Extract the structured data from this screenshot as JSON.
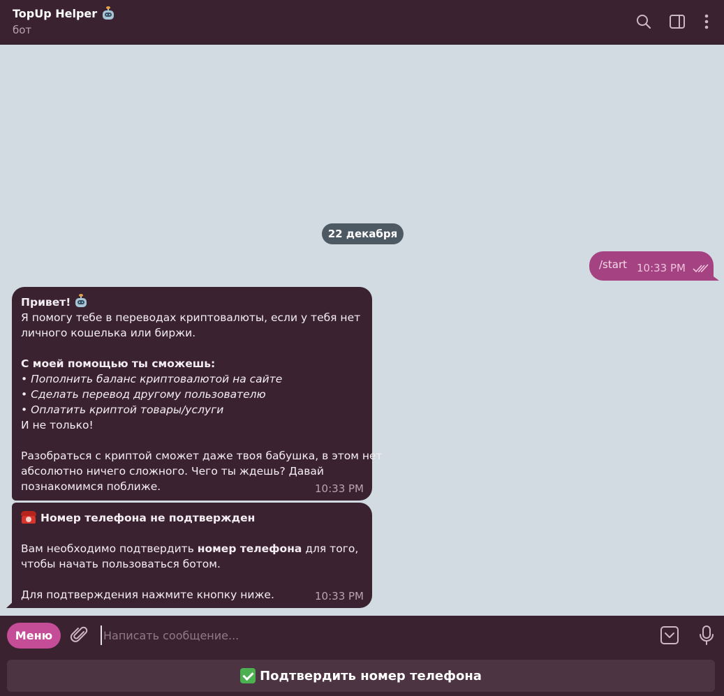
{
  "header": {
    "title": "TopUp Helper",
    "title_emoji": "robot",
    "subtitle": "бот",
    "icons": [
      "search-icon",
      "sidebar-toggle-icon",
      "more-vertical-icon"
    ]
  },
  "chat": {
    "date_separator": "22 декабря",
    "outgoing": {
      "text": "/start",
      "time": "10:33 PM",
      "status": "read"
    },
    "welcome": {
      "greeting": "Привет!",
      "line1": "Я помогу тебе в переводах криптовалюты, если у тебя нет",
      "line2": "личного кошелька или биржи.",
      "features_title": "С моей помощью ты сможешь:",
      "feature1": "• Пополнить баланс криптовалютой на сайте",
      "feature2": "• Сделать перевод другому пользователю",
      "feature3": "• Оплатить криптой товары/услуги",
      "more": "И не только!",
      "outro1": "Разобраться с криптой сможет даже твоя бабушка, в этом нет",
      "outro2": "абсолютно ничего сложного. Чего ты ждешь? Давай",
      "outro3": "познакомимся поближе.",
      "time": "10:33 PM"
    },
    "phone_notice": {
      "title": "Номер телефона не подтвержден",
      "body_prefix": "Вам необходимо подтвердить ",
      "body_bold": "номер телефона",
      "body_suffix": " для того,",
      "body_line2": "чтобы начать пользоваться ботом.",
      "instruction": "Для подтверждения нажмите кнопку ниже.",
      "time": "10:33 PM"
    }
  },
  "composer": {
    "menu_label": "Меню",
    "placeholder": "Написать сообщение...",
    "value": ""
  },
  "reply_keyboard": {
    "confirm_label": "Подтвердить номер телефона"
  },
  "colors": {
    "header_bg": "#3a2231",
    "chat_bg": "#d3dbe2",
    "incoming_bubble": "#3b2230",
    "outgoing_bubble": "#a54281",
    "accent": "#c54c97"
  }
}
